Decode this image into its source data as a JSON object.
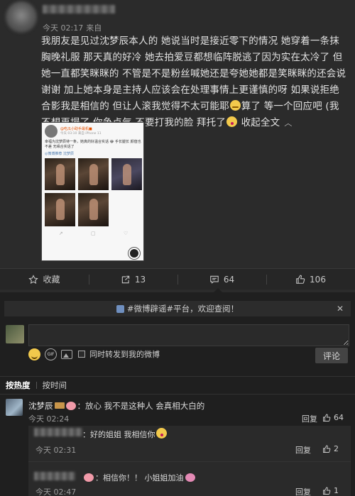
{
  "post": {
    "meta_time": "今天 02:17",
    "meta_source": "来自",
    "text": "我朋友是见过沈梦辰本人的  她说当时是接近零下的情况  她穿着一条抹胸晚礼服  那天真的好冷  她去拍爱豆都想临阵脱逃了因为实在太冷了 但她一直都笑眯眯的  不管是不是粉丝喊她还是夸她她都是笑眯眯的还会说谢谢   加上她本身是主持人应该会在处理事情上更谨慎的呀   如果说拒绝合影我是相信的  但让人滚我觉得不太可能耶",
    "text_2": "算了  等一个回应吧  (我不想再塌了  你争点气  不要打我的脸  拜托了",
    "collapse_label": "收起全文",
    "collapse_icon": "chevron-up-icon",
    "screenshot": {
      "name": "@吃瓜小助手最机■",
      "time": "今天 03:10 来自 iPhone 11",
      "text": "幸福为沈梦辰待一条，她真的好温合实话 😂 手长腿长 颜值也不差 无缘合实话了",
      "tag": "◎微博推荐 沈梦辰"
    }
  },
  "actions": [
    {
      "label": "收藏",
      "icon": "star-icon"
    },
    {
      "label": "13",
      "icon": "repost-icon"
    },
    {
      "label": "64",
      "icon": "comment-icon"
    },
    {
      "label": "106",
      "icon": "thumb-up-icon"
    }
  ],
  "comments": {
    "notice": "#微博辟谣#平台，欢迎查阅！",
    "input_placeholder": "",
    "forward_label": "同时转发到我的微博",
    "submit_label": "评论",
    "sort_hot": "按热度",
    "sort_time": "按时间",
    "items": [
      {
        "author": "沈梦辰",
        "text": "：放心 我不是这种人 会真相大白的",
        "time": "今天 02:24",
        "reply": "回复",
        "likes": "64"
      }
    ],
    "replies": [
      {
        "text": "：好的姐姐  我相信你",
        "time": "今天 02:31",
        "reply": "回复",
        "likes": "2"
      },
      {
        "text": "：相信你！！ 小姐姐加油",
        "time": "今天 02:47",
        "reply": "回复",
        "likes": "1"
      }
    ]
  }
}
